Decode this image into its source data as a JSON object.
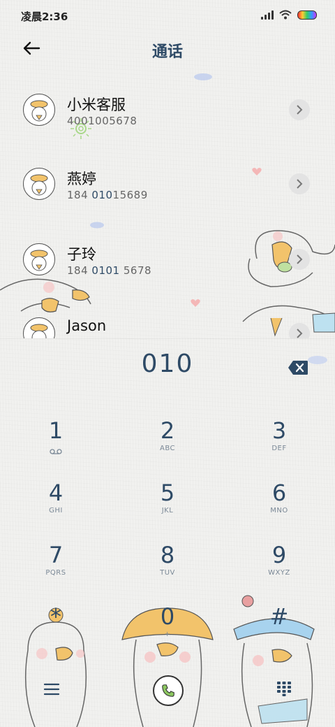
{
  "status": {
    "time": "凌晨2:36"
  },
  "header": {
    "title": "通话"
  },
  "contacts": [
    {
      "name": "小米客服",
      "number_pre": "",
      "number_hl": "",
      "number_post": "4001005678"
    },
    {
      "name": "燕婷",
      "number_pre": "184 ",
      "number_hl": "010",
      "number_post": "15689"
    },
    {
      "name": "子玲",
      "number_pre": "184 ",
      "number_hl": "0101",
      "number_post": " 5678"
    },
    {
      "name": "Jason",
      "number_pre": "",
      "number_hl": "",
      "number_post": ""
    }
  ],
  "dialer": {
    "display": "010",
    "keys": [
      {
        "digit": "1",
        "letters": ""
      },
      {
        "digit": "2",
        "letters": "ABC"
      },
      {
        "digit": "3",
        "letters": "DEF"
      },
      {
        "digit": "4",
        "letters": "GHI"
      },
      {
        "digit": "5",
        "letters": "JKL"
      },
      {
        "digit": "6",
        "letters": "MNO"
      },
      {
        "digit": "7",
        "letters": "PQRS"
      },
      {
        "digit": "8",
        "letters": "TUV"
      },
      {
        "digit": "9",
        "letters": "WXYZ"
      },
      {
        "digit": "*",
        "letters": ""
      },
      {
        "digit": "0",
        "letters": "+"
      },
      {
        "digit": "#",
        "letters": ""
      }
    ]
  },
  "icons": {
    "back": "arrow-left-icon",
    "chevron": "chevron-right-icon",
    "backspace": "backspace-icon",
    "voicemail": "voicemail-icon",
    "call": "phone-icon",
    "menu": "menu-icon",
    "keypad": "dialpad-icon"
  },
  "colors": {
    "accent": "#2e4a66",
    "background": "#f1f1ef"
  }
}
